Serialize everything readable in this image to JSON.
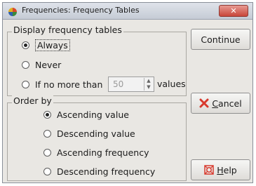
{
  "window": {
    "title": "Frequencies: Frequency Tables",
    "close_glyph": "✕"
  },
  "display_group": {
    "label": "Display frequency tables",
    "options": [
      {
        "label": "Always",
        "checked": true
      },
      {
        "label": "Never",
        "checked": false
      },
      {
        "label": "If no more than",
        "checked": false
      }
    ],
    "limit_value": "50",
    "limit_suffix": "values"
  },
  "order_group": {
    "label": "Order by",
    "options": [
      {
        "label": "Ascending value",
        "checked": true
      },
      {
        "label": "Descending value",
        "checked": false
      },
      {
        "label": "Ascending frequency",
        "checked": false
      },
      {
        "label": "Descending frequency",
        "checked": false
      }
    ]
  },
  "buttons": {
    "continue": "Continue",
    "cancel_mnemonic": "C",
    "cancel_rest": "ancel",
    "help_mnemonic": "H",
    "help_rest": "elp"
  },
  "icons": {
    "app": "spss-app-icon",
    "cancel": "red-x-icon",
    "help": "help-lifebuoy-icon"
  },
  "colors": {
    "close_button": "#c8463a",
    "cancel_icon": "#d83a2e",
    "help_icon": "#d83a2e"
  }
}
